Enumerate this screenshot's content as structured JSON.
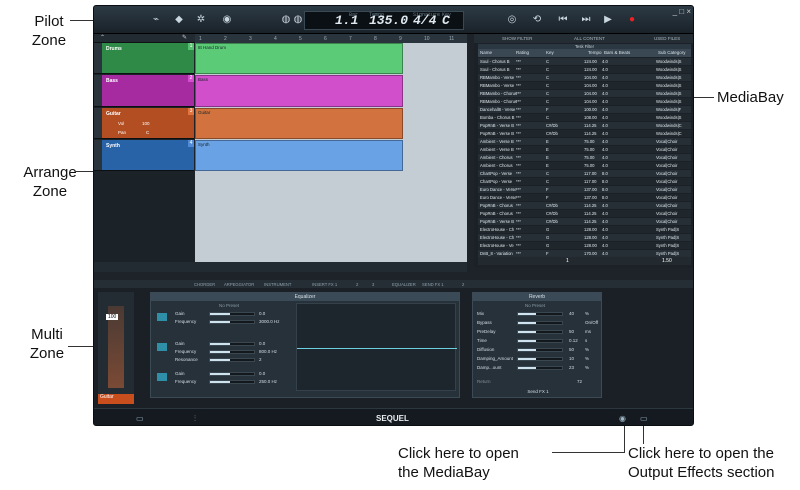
{
  "callouts": {
    "pilot": "Pilot\nZone",
    "arrange": "Arrange\nZone",
    "multi": "Multi\nZone",
    "mediabay": "MediaBay",
    "click_mediabay_1": "Click here to open",
    "click_mediabay_2": "the MediaBay",
    "click_output_1": "Click here to open the",
    "click_output_2": "Output Effects section"
  },
  "transport": {
    "bar": "1.1",
    "bar_label": "Bar",
    "tempo": "135.0",
    "tempo_label": "Tempo",
    "signature": "4/4",
    "signature_label": "Signature",
    "key": "C",
    "key_label": "Key"
  },
  "tracks": [
    {
      "name": "Drums",
      "number": "1",
      "color": "#2f8a47"
    },
    {
      "name": "Bass",
      "number": "2",
      "color": "#a62aa0"
    },
    {
      "name": "Guitar",
      "number": "3",
      "color": "#b24e22",
      "vol": "100",
      "pan": "C",
      "vol_label": "Vol",
      "pan_label": "Pan"
    },
    {
      "name": "Synth",
      "number": "4",
      "color": "#2863a8"
    }
  ],
  "parts": {
    "drums": "8t Hand Drum",
    "bass": "Bass",
    "guitar": "Guitar",
    "synth": "Synth"
  },
  "ruler": [
    "1",
    "2",
    "3",
    "4",
    "5",
    "6",
    "7",
    "8",
    "9",
    "10",
    "11"
  ],
  "mediabay": {
    "tabs": [
      "SHOW FILTER",
      "ALL CONTENT",
      "USED FILES"
    ],
    "filter_title": "Tesk Filter",
    "columns": [
      "Name",
      "Rating",
      "Key",
      "Tempo",
      "Bars & Beats",
      "Sub Category"
    ],
    "rows": [
      [
        "Soul - Chorus B",
        "***",
        "C",
        "124.00",
        "4.0",
        "Woodwinds|S"
      ],
      [
        "Soul - Chorus B",
        "***",
        "C",
        "124.00",
        "4.0",
        "Woodwinds|S"
      ],
      [
        "RBMambo - Verse",
        "***",
        "C",
        "104.00",
        "4.0",
        "Woodwinds|S"
      ],
      [
        "RBMambo - Verse",
        "***",
        "C",
        "104.00",
        "4.0",
        "Woodwinds|S"
      ],
      [
        "RBMambo - Chorus",
        "***",
        "C",
        "104.00",
        "4.0",
        "Woodwinds|S"
      ],
      [
        "RBMambo - Chorus",
        "***",
        "C",
        "104.00",
        "4.0",
        "Woodwinds|S"
      ],
      [
        "Dancehall8 - Verse",
        "***",
        "F",
        "100.00",
        "4.0",
        "Woodwinds|F"
      ],
      [
        "Bomba - Chorus B",
        "***",
        "C",
        "108.00",
        "4.0",
        "Woodwinds|S"
      ],
      [
        "PopRnB - Verse B",
        "***",
        "C#/Db",
        "114.25",
        "4.0",
        "Woodwinds|C"
      ],
      [
        "PopRnB - Verse B",
        "***",
        "C#/Db",
        "114.25",
        "4.0",
        "Woodwinds|C"
      ],
      [
        "Ambient - Verse B",
        "***",
        "E",
        "75.00",
        "4.0",
        "Vocal|Choir"
      ],
      [
        "Ambient - Verse B",
        "***",
        "E",
        "75.00",
        "4.0",
        "Vocal|Choir"
      ],
      [
        "Ambient - Chorus",
        "***",
        "E",
        "75.00",
        "4.0",
        "Vocal|Choir"
      ],
      [
        "Ambient - Chorus",
        "***",
        "E",
        "75.00",
        "4.0",
        "Vocal|Choir"
      ],
      [
        "ChartPop - Verse",
        "***",
        "C",
        "117.00",
        "8.0",
        "Vocal|Choir"
      ],
      [
        "ChartPop - Verse",
        "***",
        "C",
        "117.00",
        "8.0",
        "Vocal|Choir"
      ],
      [
        "Euro Dance - Verse",
        "***",
        "F",
        "137.00",
        "8.0",
        "Vocal|Choir"
      ],
      [
        "Euro Dance - Verse",
        "***",
        "F",
        "137.00",
        "8.0",
        "Vocal|Choir"
      ],
      [
        "PopRnB - Chorus",
        "***",
        "C#/Db",
        "114.25",
        "4.0",
        "Vocal|Choir"
      ],
      [
        "PopRnB - Chorus",
        "***",
        "C#/Db",
        "114.25",
        "4.0",
        "Vocal|Choir"
      ],
      [
        "PopRnB - Verse B",
        "***",
        "C#/Db",
        "114.25",
        "4.0",
        "Vocal|Choir"
      ],
      [
        "ElectroHouse - Ch",
        "***",
        "G",
        "128.00",
        "4.0",
        "Synth Pad|S"
      ],
      [
        "ElectroHouse - Ch",
        "***",
        "G",
        "128.00",
        "4.0",
        "Synth Pad|S"
      ],
      [
        "ElectroHouse - Ve",
        "***",
        "G",
        "128.00",
        "4.0",
        "Synth Pad|S"
      ],
      [
        "DnB_8 - Variation",
        "***",
        "F",
        "170.00",
        "4.0",
        "Synth Pad|S"
      ]
    ],
    "page": "1",
    "count": "1.50"
  },
  "multi": {
    "tabs": [
      "CHORDER",
      "ARPEGGIATOR",
      "INSTRUMENT",
      "INSERT FX 1",
      "2",
      "3",
      "EQUALIZER",
      "SEND FX 1",
      "2"
    ],
    "fader_value": "100",
    "channel": "Guitar",
    "eq": {
      "title": "Equalizer",
      "preset": "No Preset",
      "bands": [
        {
          "gain_label": "Gain",
          "gain": "0.0",
          "freq_label": "Frequency",
          "freq": "3000.0 Hz"
        },
        {
          "gain_label": "Gain",
          "gain": "0.0",
          "freq_label": "Frequency",
          "freq": "800.0 Hz",
          "res_label": "Resonance",
          "res": "2"
        },
        {
          "gain_label": "Gain",
          "gain": "0.0",
          "freq_label": "Frequency",
          "freq": "250.0 Hz"
        }
      ]
    },
    "reverb": {
      "title": "Reverb",
      "preset": "No Preset",
      "params": [
        [
          "Mix",
          "40",
          "%"
        ],
        [
          "Bypass",
          "",
          "On/Off"
        ],
        [
          "PreDelay",
          "50",
          "ms"
        ],
        [
          "Time",
          "0.12",
          "s"
        ],
        [
          "Diffusion",
          "50",
          "%"
        ],
        [
          "Damping_Amount",
          "10",
          "%"
        ],
        [
          "Damp...ount",
          "23",
          "%"
        ]
      ],
      "footer": "Send FX 1",
      "return_label": "Return",
      "return_value": "72"
    }
  },
  "bottom": {
    "title": "SEQUEL"
  }
}
